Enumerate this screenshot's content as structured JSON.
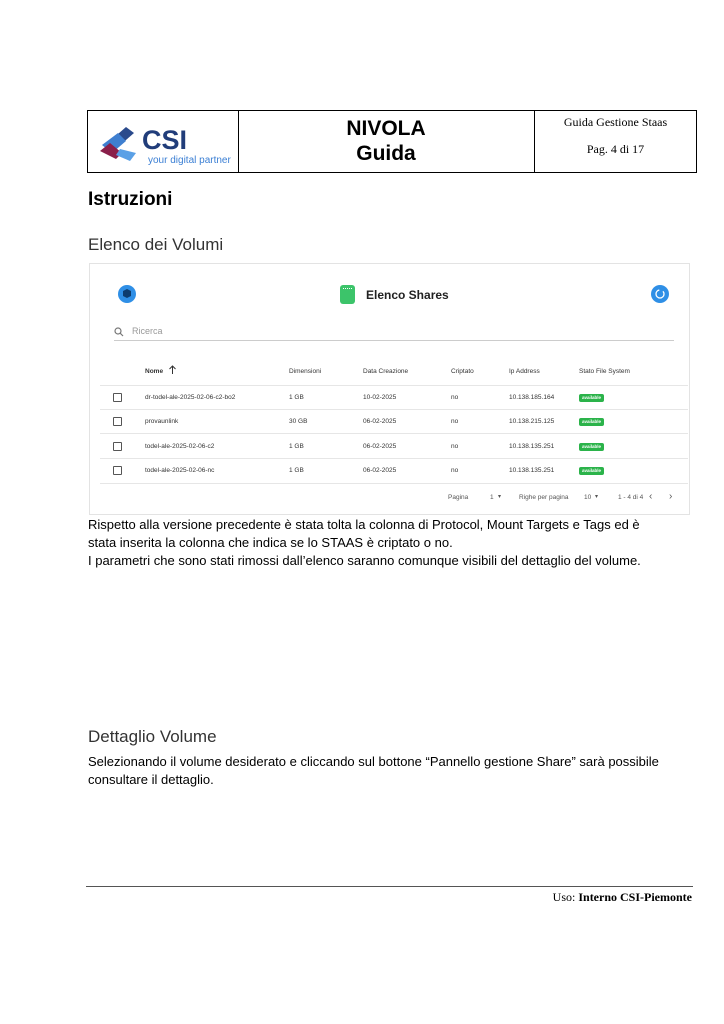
{
  "header": {
    "logo_text": "CSI",
    "logo_tagline": "your digital partner",
    "title_line1": "NIVOLA",
    "title_line2": "Guida",
    "doc_name": "Guida Gestione Staas",
    "page": "Pag. 4 di 17"
  },
  "section_title": "Istruzioni",
  "sub1": "Elenco dei Volumi",
  "panel": {
    "title": "Elenco Shares",
    "search_placeholder": "Ricerca",
    "columns": [
      "Nome",
      "Dimensioni",
      "Data Creazione",
      "Criptato",
      "Ip Address",
      "Stato File System"
    ],
    "sort_icon": "arrow-up-icon",
    "rows": [
      {
        "nome": "dr-todel-ale-2025-02-06-c2-bo2",
        "dim": "1 GB",
        "data": "10-02-2025",
        "cript": "no",
        "ip": "10.138.185.164",
        "stato": "available"
      },
      {
        "nome": "provaunlink",
        "dim": "30 GB",
        "data": "06-02-2025",
        "cript": "no",
        "ip": "10.138.215.125",
        "stato": "available"
      },
      {
        "nome": "todel-ale-2025-02-06-c2",
        "dim": "1 GB",
        "data": "06-02-2025",
        "cript": "no",
        "ip": "10.138.135.251",
        "stato": "available"
      },
      {
        "nome": "todel-ale-2025-02-06-nc",
        "dim": "1 GB",
        "data": "06-02-2025",
        "cript": "no",
        "ip": "10.138.135.251",
        "stato": "available"
      }
    ],
    "footer": {
      "pagina_label": "Pagina",
      "pagina_value": "1",
      "righe_label": "Righe per pagina",
      "righe_value": "10",
      "range": "1 - 4 di 4"
    },
    "colors": {
      "accent": "#2f8fe6",
      "badge": "#2bb34a",
      "shares_icon": "#3cc46a"
    }
  },
  "para1_line1": "Rispetto alla versione precedente è stata tolta la colonna di Protocol, Mount Targets e Tags ed è",
  "para1_line2": "stata inserita la colonna che indica se lo STAAS è criptato o no.",
  "para1_line3": "I parametri che sono stati rimossi dall’elenco saranno comunque visibili del dettaglio del volume.",
  "sub2": "Dettaglio Volume",
  "para2_line1": "Selezionando il volume desiderato e cliccando sul bottone “Pannello gestione Share” sarà possibile",
  "para2_line2": "consultare il dettaglio.",
  "footer": {
    "uso_label": "Uso: ",
    "uso_value": "Interno CSI-Piemonte"
  }
}
